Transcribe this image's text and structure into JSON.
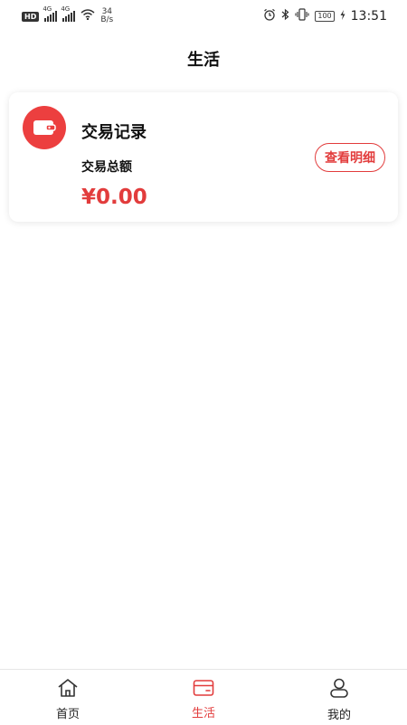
{
  "status_bar": {
    "hd": "HD",
    "net1": "4G",
    "net2": "4G",
    "speed_value": "34",
    "speed_unit": "B/s",
    "battery": "100",
    "time": "13:51"
  },
  "header": {
    "title": "生活"
  },
  "card": {
    "icon": "wallet-icon",
    "title": "交易记录",
    "label": "交易总额",
    "amount": "¥0.00",
    "detail_button": "查看明细"
  },
  "tabbar": {
    "tabs": [
      {
        "label": "首页",
        "icon": "home-icon",
        "active": false
      },
      {
        "label": "生活",
        "icon": "card-icon",
        "active": true
      },
      {
        "label": "我的",
        "icon": "user-icon",
        "active": false
      }
    ]
  },
  "colors": {
    "accent": "#e23c3c",
    "icon_bg": "#ec3f3f"
  }
}
